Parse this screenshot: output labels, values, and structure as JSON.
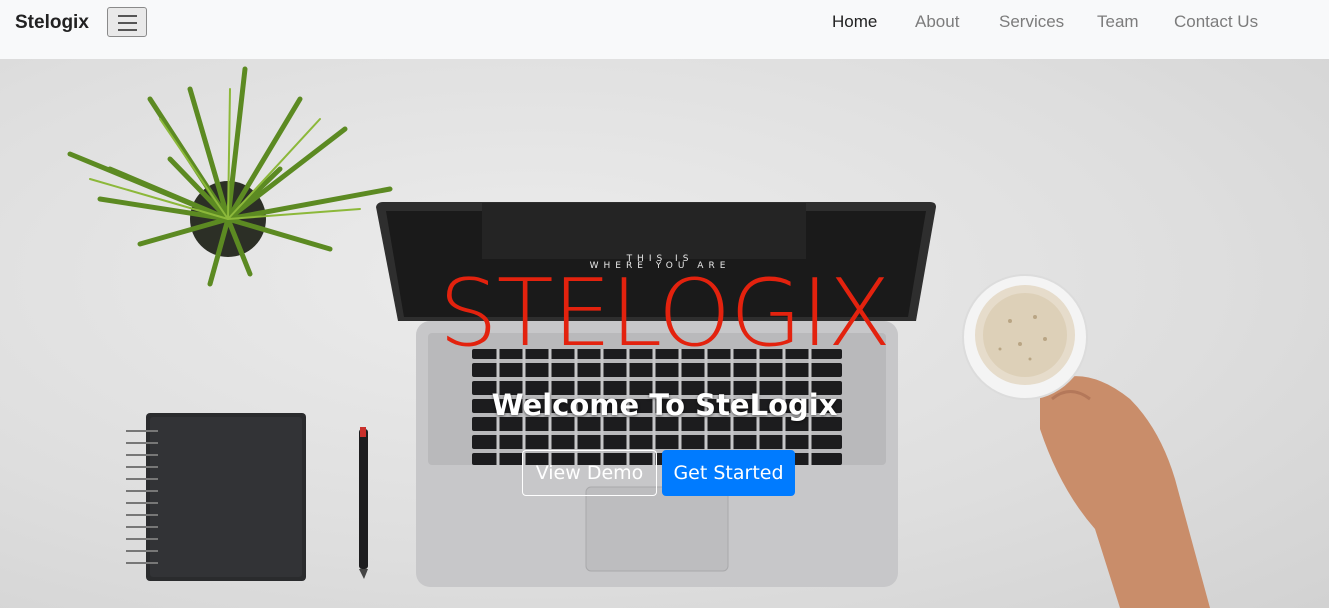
{
  "navbar": {
    "brand": "Stelogix",
    "toggler_icon": "hamburger-menu-icon",
    "links": [
      "Home",
      "About",
      "Services",
      "Team",
      "Contact Us"
    ],
    "active": "Home"
  },
  "hero": {
    "title": "STELOGIX",
    "subtitle": "Welcome To SteLogix",
    "primary_button": "Get Started",
    "secondary_button": "View Demo",
    "screen_text_line1": "THIS IS",
    "screen_text_line2": "WHERE YOU ARE",
    "title_color": "#e3220e",
    "primary_color": "#007bff"
  }
}
